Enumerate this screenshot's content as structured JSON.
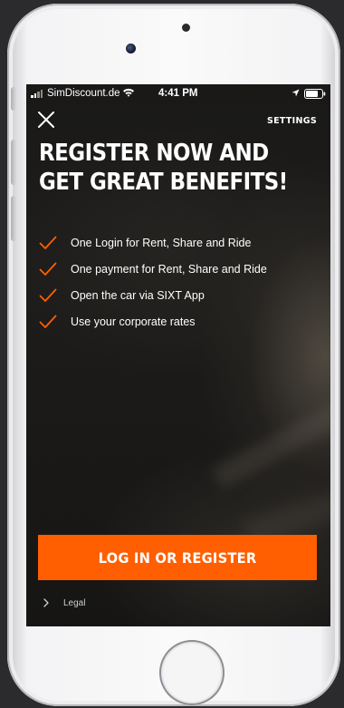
{
  "status_bar": {
    "carrier": "SimDiscount.de",
    "time": "4:41 PM"
  },
  "header": {
    "close_icon": "close-icon",
    "settings_label": "SETTINGS"
  },
  "headline": "REGISTER NOW AND GET GREAT BENEFITS!",
  "benefits": [
    "One Login for Rent, Share and Ride",
    "One payment for Rent, Share and Ride",
    "Open the car via SIXT App",
    "Use your corporate rates"
  ],
  "cta_label": "LOG IN OR REGISTER",
  "legal_label": "Legal",
  "colors": {
    "accent": "#ff5f00",
    "check": "#ff5f00",
    "text": "#ffffff",
    "background": "#141414"
  }
}
